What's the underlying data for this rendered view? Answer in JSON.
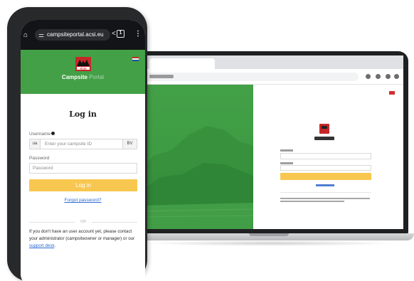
{
  "phone": {
    "url": "campsiteportal.acsi.eu",
    "tab_count": "1",
    "header": {
      "brand_bold": "Campsite",
      "brand_light": "Portal",
      "logo_text": "ACSI"
    },
    "login": {
      "title": "Log in",
      "username_label": "Username",
      "username_prefix": "ua",
      "username_placeholder": "Enter your campsite ID",
      "username_suffix": "BV",
      "password_label": "Password",
      "password_placeholder": "Password",
      "button": "Log in",
      "forgot_link": "Forgot password?",
      "or_text": "OR",
      "info_text": "If you don't have an user account yet, please contact your administrator (campsiteowner or manager) or our ",
      "support_link": "support desk",
      "info_end": "."
    }
  },
  "colors": {
    "green": "#43a047",
    "yellow": "#f8c74f",
    "link": "#2f6bd1"
  }
}
